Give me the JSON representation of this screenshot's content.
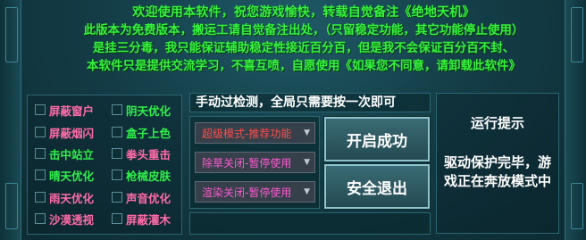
{
  "notice": {
    "line1": "欢迎使用本软件，祝您游戏愉快，转载自觉备注《绝地天机》",
    "line2": "此版本为免费版本，搬运工请自觉备注出处，（只留稳定功能，其它功能停止使用）",
    "line3": "是挂三分毒，我只能保证辅助稳定性接近百分百，但是我不会保证百分百不封、",
    "line4": "本软件只是提供交流学习，不喜互喷，自愿使用《如果您不同意，请卸载此软件》"
  },
  "checkboxes": [
    {
      "label": "屏蔽窗户",
      "checked": false
    },
    {
      "label": "阴天优化",
      "checked": false
    },
    {
      "label": "屏蔽烟闪",
      "checked": false
    },
    {
      "label": "盒子上色",
      "checked": false
    },
    {
      "label": "击中站立",
      "checked": false
    },
    {
      "label": "拳头重击",
      "checked": false
    },
    {
      "label": "晴天优化",
      "checked": false
    },
    {
      "label": "枪械皮肤",
      "checked": false
    },
    {
      "label": "雨天优化",
      "checked": false
    },
    {
      "label": "声音优化",
      "checked": false
    },
    {
      "label": "沙漠透视",
      "checked": false
    },
    {
      "label": "屏蔽灌木",
      "checked": false
    }
  ],
  "hint": "手动过检测，全局只需要按一次即可",
  "selects": [
    {
      "value": "超级模式-推荐功能"
    },
    {
      "value": "除草关闭-暂停使用"
    },
    {
      "value": "渲染关闭-暂停使用"
    }
  ],
  "buttons": {
    "open": "开启成功",
    "exit": "安全退出"
  },
  "status": {
    "title": "运行提示",
    "message": "驱动保护完毕，游戏正在奔放模式中"
  },
  "colors": {
    "notice_text": "#36f23e",
    "pink_label": "#ff6ba8",
    "green_label": "#2ff04a",
    "cyan_label": "#7ef3ff",
    "select_red": "#ff4d4d",
    "select_pink": "#ff5ad0"
  }
}
